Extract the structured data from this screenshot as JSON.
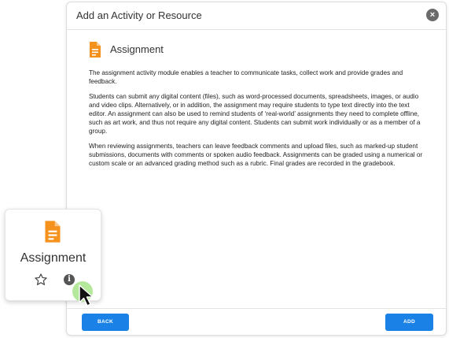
{
  "dialog": {
    "title": "Add an Activity or Resource",
    "close_glyph": "×",
    "module_title": "Assignment",
    "paragraphs": [
      "The assignment activity module enables a teacher to communicate tasks, collect work and provide grades and feedback.",
      "Students can submit any digital content (files), such as word-processed documents, spreadsheets, images, or audio and video clips. Alternatively, or in addition, the assignment may require students to type text directly into the text editor. An assignment can also be used to remind students of ‘real-world’ assignments they need to complete offline, such as art work, and thus not require any digital content. Students can submit work individually or as a member of a group.",
      "When reviewing assignments, teachers can leave feedback comments and upload files, such as marked-up student submissions, documents with comments or spoken audio feedback. Assignments can be graded using a numerical or custom scale or an advanced grading method such as a rubric. Final grades are recorded in the gradebook."
    ],
    "back_label": "BACK",
    "add_label": "ADD"
  },
  "card": {
    "label": "Assignment",
    "info_glyph": "i"
  },
  "icons": {
    "module": "assignment-document-icon",
    "favourite": "star-outline-icon",
    "info": "info-icon",
    "close": "close-icon",
    "cursor": "mouse-pointer-icon"
  },
  "colors": {
    "accent": "#1a82e6",
    "assignment_icon": "#f5921e",
    "cursor_highlight": "#9be07a"
  }
}
